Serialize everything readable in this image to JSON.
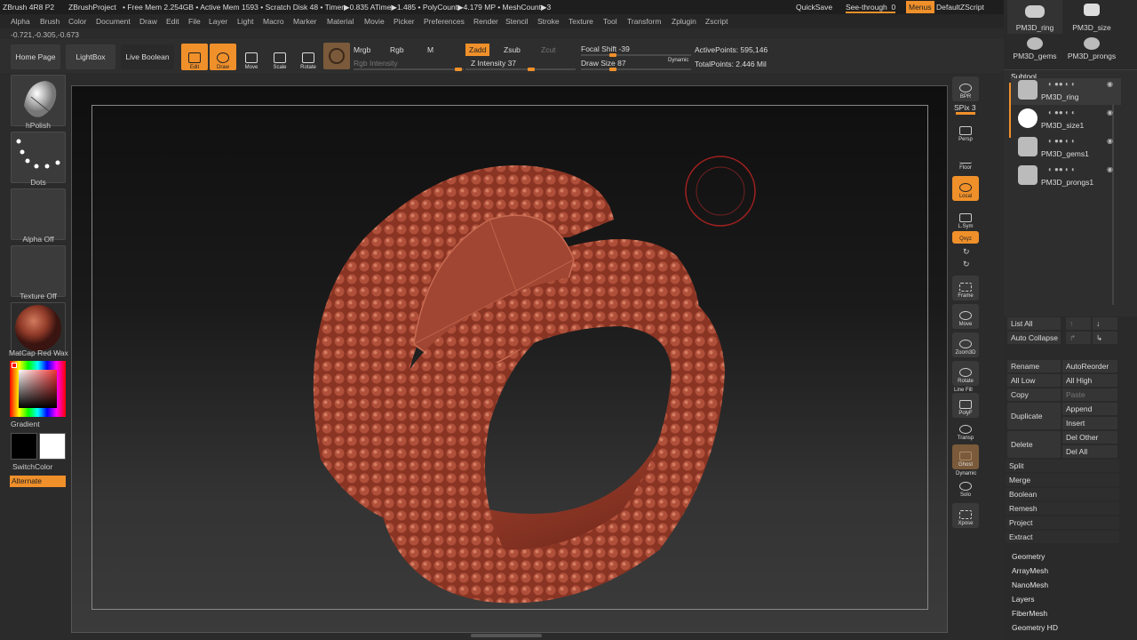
{
  "titlebar": {
    "app": "ZBrush 4R8 P2",
    "project": "ZBrushProject",
    "stats": "• Free Mem 2.254GB • Active Mem 1593 • Scratch Disk 48 • Timer▶0.835 ATime▶1.485 • PolyCount▶4.179 MP • MeshCount▶3",
    "quicksave": "QuickSave",
    "seethrough": "See-through",
    "seethrough_value": "0",
    "menus": "Menus",
    "script": "DefaultZScript"
  },
  "menubar": [
    "Alpha",
    "Brush",
    "Color",
    "Document",
    "Draw",
    "Edit",
    "File",
    "Layer",
    "Light",
    "Macro",
    "Marker",
    "Material",
    "Movie",
    "Picker",
    "Preferences",
    "Render",
    "Stencil",
    "Stroke",
    "Texture",
    "Tool",
    "Transform",
    "Zplugin",
    "Zscript"
  ],
  "coords": "-0.721,-0.305,-0.673",
  "shelf": {
    "home": "Home Page",
    "lightbox": "LightBox",
    "live_boolean": "Live Boolean",
    "edit": "Edit",
    "draw": "Draw",
    "move": "Move",
    "scale": "Scale",
    "rotate": "Rotate",
    "mrgb": "Mrgb",
    "rgb": "Rgb",
    "m": "M",
    "rgb_intensity": "Rgb Intensity",
    "zadd": "Zadd",
    "zsub": "Zsub",
    "zcut": "Zcut",
    "z_intensity": "Z Intensity 37",
    "focal_shift": "Focal Shift -39",
    "draw_size": "Draw Size 87",
    "dynamic": "Dynamic",
    "active_points": "ActivePoints: 595,146",
    "total_points": "TotalPoints: 2.446 Mil"
  },
  "leftbar": {
    "brush": "hPolish",
    "stroke": "Dots",
    "alpha": "Alpha Off",
    "texture": "Texture Off",
    "material": "MatCap Red Wax",
    "gradient": "Gradient",
    "switchcolor": "SwitchColor",
    "alternate": "Alternate"
  },
  "rightstrip": {
    "bpr": "BPR",
    "spix": "SPix 3",
    "dynamic": "Dynamic",
    "persp": "Persp",
    "floor": "Floor",
    "local": "Local",
    "lsym": "L.Sym",
    "xyz": "Qxyz",
    "frame": "Frame",
    "move": "Move",
    "zoom3d": "Zoom3D",
    "rotate": "Rotate",
    "linefill": "Line Fill",
    "polyf": "PolyF",
    "transp": "Transp",
    "ghost": "Ghost",
    "dynamic2": "Dynamic",
    "solo": "Solo",
    "xpose": "Xpose"
  },
  "panel": {
    "tools": [
      "PM3D_ring",
      "PM3D_size",
      "PM3D_gems",
      "PM3D_prongs"
    ],
    "subtool_title": "Subtool",
    "subtools": [
      "PM3D_ring",
      "PM3D_size1",
      "PM3D_gems1",
      "PM3D_prongs1"
    ],
    "list_all": "List All",
    "auto_collapse": "Auto Collapse",
    "rename": "Rename",
    "autoreorder": "AutoReorder",
    "all_low": "All Low",
    "all_high": "All High",
    "copy": "Copy",
    "paste": "Paste",
    "duplicate": "Duplicate",
    "append": "Append",
    "insert": "Insert",
    "delete": "Delete",
    "del_other": "Del Other",
    "del_all": "Del All",
    "split": "Split",
    "merge": "Merge",
    "boolean": "Boolean",
    "remesh": "Remesh",
    "project": "Project",
    "extract": "Extract",
    "sections": [
      "Geometry",
      "ArrayMesh",
      "NanoMesh",
      "Layers",
      "FiberMesh",
      "Geometry HD"
    ]
  },
  "colors": {
    "accent": "#f0902a",
    "ring": "#9a3f2d"
  }
}
